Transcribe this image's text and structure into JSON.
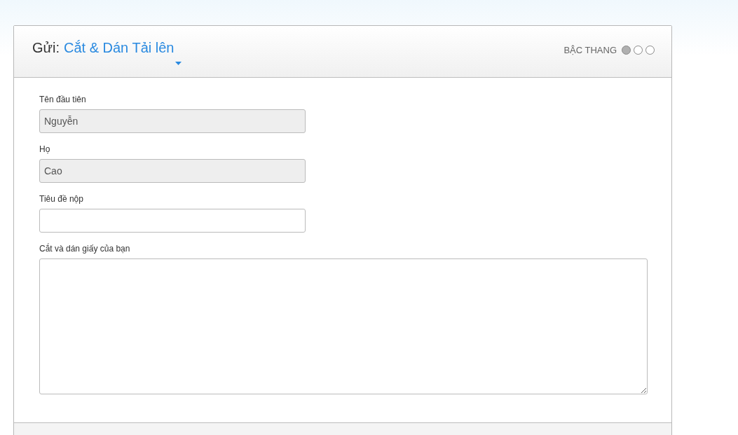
{
  "header": {
    "prefix": "Gửi:",
    "title": "Cắt & Dán Tải lên",
    "steps_label": "BẬC THANG",
    "steps": [
      {
        "selected": true
      },
      {
        "selected": false
      },
      {
        "selected": false
      }
    ]
  },
  "fields": [
    {
      "kind": "input",
      "label": "Tên đầu tiên",
      "value": "Nguyễn",
      "disabled": true
    },
    {
      "kind": "input",
      "label": "Họ",
      "value": "Cao",
      "disabled": true
    },
    {
      "kind": "input",
      "label": "Tiêu đề nộp",
      "disabled": false
    },
    {
      "kind": "textarea",
      "label": "Cắt và dán giấy của bạn",
      "disabled": false
    }
  ]
}
